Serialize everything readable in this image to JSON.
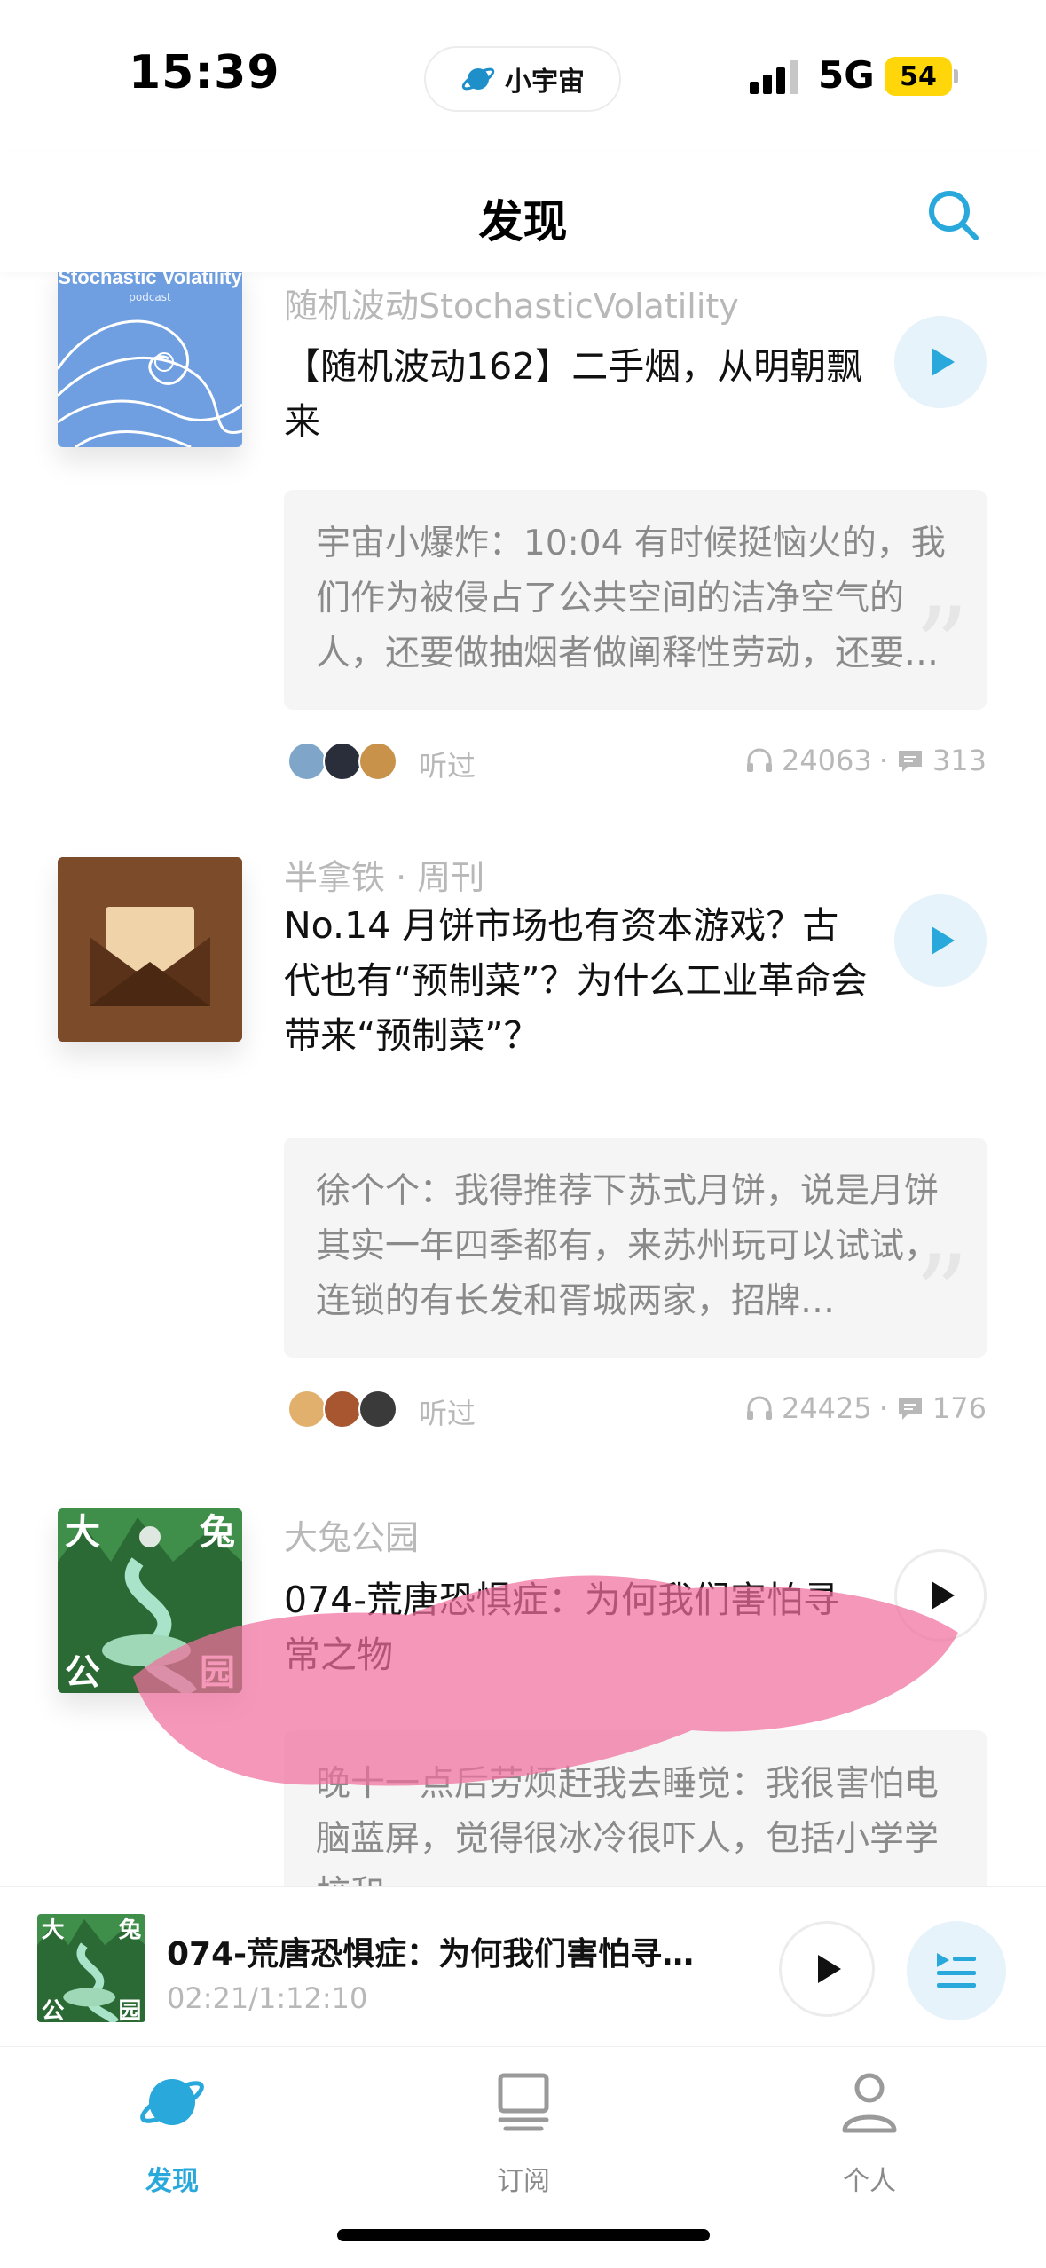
{
  "status_bar": {
    "time": "15:39",
    "app_name": "小宇宙",
    "network": "5G",
    "battery": "54"
  },
  "header": {
    "title": "发现",
    "search_icon": "search-icon"
  },
  "feed": [
    {
      "podcast": "随机波动StochasticVolatility",
      "cover_text": "Stochastic Volatility",
      "cover_subtext": "podcast",
      "title": "【随机波动162】二手烟，从明朝飘来",
      "comment": "宇宙小爆炸：10:04 有时候挺恼火的，我们作为被侵占了公共空间的洁净空气的人，还要做抽烟者做阐释性劳动，还要被迫阐释，我们也…",
      "listened_label": "听过",
      "plays": "24063",
      "comments": "313"
    },
    {
      "podcast": "半拿铁 · 周刊",
      "title": "No.14 月饼市场也有资本游戏？古代也有“预制菜”？为什么工业革命会带来“预制菜”？",
      "comment": "徐个个：我得推荐下苏式月饼，说是月饼其实一年四季都有，来苏州玩可以试试，连锁的有长发和胥城两家，招牌…",
      "listened_label": "听过",
      "plays": "24425",
      "comments": "176"
    },
    {
      "podcast": "大兔公园",
      "title": "074-荒唐恐惧症：为何我们害怕寻常之物",
      "comment": "晚十一点后劳烦赶我去睡觉：我很害怕电脑蓝屏，觉得很冰冷很吓人，包括小学学校和…"
    }
  ],
  "mini_player": {
    "title": "074-荒唐恐惧症：为何我们害怕寻…",
    "time": "02:21/1:12:10"
  },
  "tabs": [
    {
      "label": "发现",
      "icon": "planet-icon",
      "active": true
    },
    {
      "label": "订阅",
      "icon": "inbox-icon",
      "active": false
    },
    {
      "label": "个人",
      "icon": "person-icon",
      "active": false
    }
  ],
  "colors": {
    "accent": "#29a8dc",
    "battery": "#ffd60a",
    "scribble": "#f06f9c"
  }
}
